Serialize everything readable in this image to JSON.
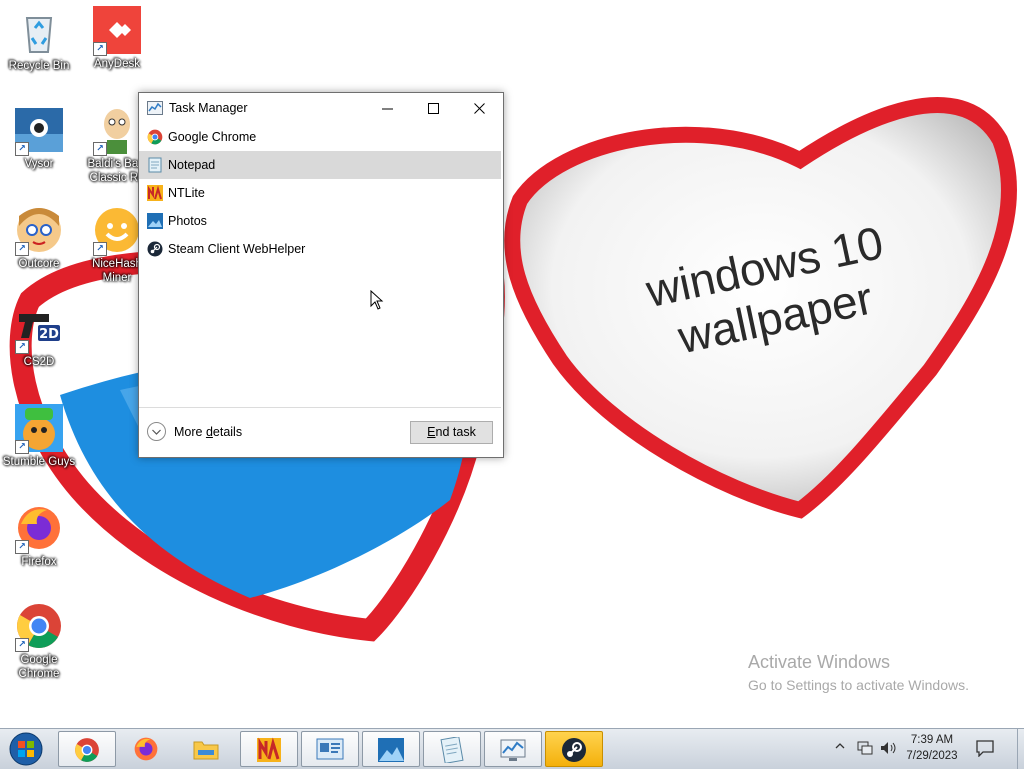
{
  "wallpaper": {
    "text_line1": "windows 10",
    "text_line2": "wallpaper",
    "watermark_title": "Activate Windows",
    "watermark_sub": "Go to Settings to activate Windows."
  },
  "desktop_icons": [
    {
      "label": "Recycle Bin",
      "icon": "recycle-bin-icon"
    },
    {
      "label": "AnyDesk",
      "icon": "anydesk-icon"
    },
    {
      "label": "Vysor",
      "icon": "vysor-icon"
    },
    {
      "label": "Baldi's Basi Classic Re",
      "icon": "baldi-icon"
    },
    {
      "label": "Outcore",
      "icon": "outcore-icon"
    },
    {
      "label": "NiceHash Miner",
      "icon": "nicehash-icon"
    },
    {
      "label": "CS2D",
      "icon": "cs2d-icon"
    },
    {
      "label": "Stumble Guys",
      "icon": "stumble-guys-icon"
    },
    {
      "label": "Firefox",
      "icon": "firefox-icon"
    },
    {
      "label": "Google Chrome",
      "icon": "chrome-icon"
    }
  ],
  "task_manager": {
    "title": "Task Manager",
    "apps": [
      {
        "name": "Google Chrome",
        "icon": "chrome-icon"
      },
      {
        "name": "Notepad",
        "icon": "notepad-icon",
        "selected": true
      },
      {
        "name": "NTLite",
        "icon": "ntlite-icon"
      },
      {
        "name": "Photos",
        "icon": "photos-icon"
      },
      {
        "name": "Steam Client WebHelper",
        "icon": "steam-icon"
      }
    ],
    "more_details_pre": "More ",
    "more_details_accel": "d",
    "more_details_post": "etails",
    "end_task_accel": "E",
    "end_task_post": "nd task"
  },
  "taskbar": {
    "buttons": [
      "start-orb",
      "chrome",
      "firefox",
      "file-explorer",
      "ntlite",
      "control-panel",
      "photos",
      "notepad",
      "task-manager",
      "steam"
    ],
    "active_button": "steam",
    "time": "7:39 AM",
    "date": "7/29/2023"
  },
  "colors": {
    "taskbar_top": "#e8ecf1",
    "selection": "#d9d9d9",
    "heart_red": "#e0202a"
  }
}
